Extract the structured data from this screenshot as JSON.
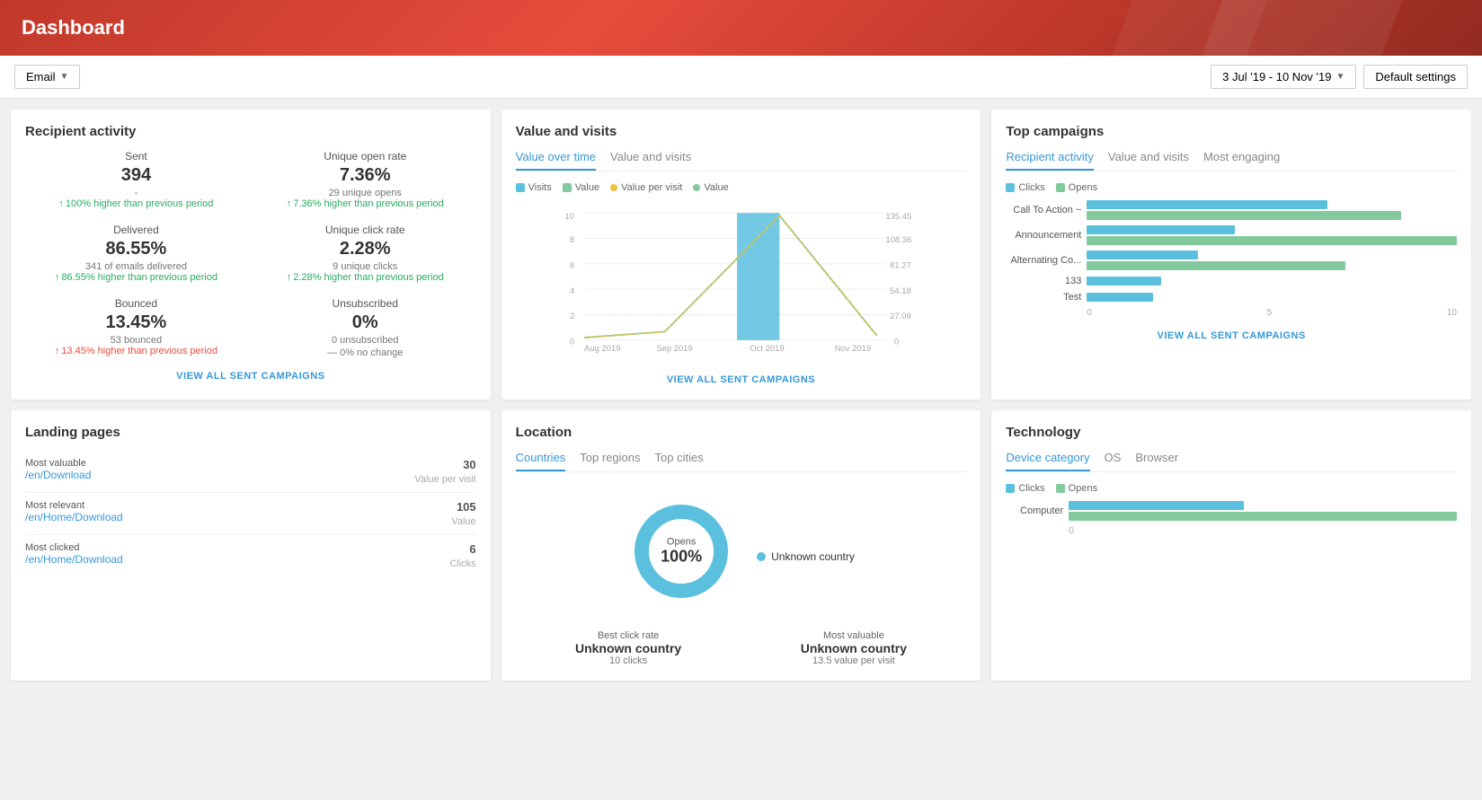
{
  "header": {
    "title": "Dashboard"
  },
  "toolbar": {
    "email_label": "Email",
    "date_range": "3 Jul '19 - 10 Nov '19",
    "settings_label": "Default settings"
  },
  "recipient_activity": {
    "title": "Recipient activity",
    "metrics": [
      {
        "label": "Sent",
        "value": "394",
        "sub": "-",
        "change": "↑ 100% higher than previous period",
        "up": true
      },
      {
        "label": "Unique open rate",
        "value": "7.36%",
        "sub": "29 unique opens",
        "change": "↑ 7.36% higher than previous period",
        "up": true
      },
      {
        "label": "Delivered",
        "value": "86.55%",
        "sub": "341 of emails delivered",
        "change": "↑ 86.55% higher than previous period",
        "up": true
      },
      {
        "label": "Unique click rate",
        "value": "2.28%",
        "sub": "9 unique clicks",
        "change": "↑ 2.28% higher than previous period",
        "up": true
      },
      {
        "label": "Bounced",
        "value": "13.45%",
        "sub": "53 bounced",
        "change": "↑ 13.45% higher than previous period",
        "up": false
      },
      {
        "label": "Unsubscribed",
        "value": "0%",
        "sub": "0 unsubscribed",
        "change": "— 0% no change",
        "neutral": true
      }
    ],
    "view_all": "VIEW ALL SENT CAMPAIGNS"
  },
  "value_visits": {
    "title": "Value and visits",
    "tabs": [
      "Value over time",
      "Value and visits"
    ],
    "active_tab": 0,
    "legend": [
      {
        "label": "Visits",
        "type": "square",
        "color": "blue"
      },
      {
        "label": "Value",
        "type": "square",
        "color": "green"
      },
      {
        "label": "Value per visit",
        "type": "circle",
        "color": "yellow"
      },
      {
        "label": "Value",
        "type": "circle",
        "color": "green2"
      }
    ],
    "x_labels": [
      "Aug 2019",
      "Sep 2019",
      "Oct 2019",
      "Nov 2019"
    ],
    "y_left": [
      "0",
      "2",
      "4",
      "6",
      "8",
      "10"
    ],
    "y_right": [
      "0",
      "27.09",
      "54.18",
      "81.27",
      "108.36",
      "135.45"
    ],
    "view_all": "VIEW ALL SENT CAMPAIGNS"
  },
  "top_campaigns": {
    "title": "Top campaigns",
    "tabs": [
      "Recipient activity",
      "Value and visits",
      "Most engaging"
    ],
    "active_tab": 0,
    "legend": [
      {
        "label": "Clicks",
        "color": "blue"
      },
      {
        "label": "Opens",
        "color": "green"
      }
    ],
    "campaigns": [
      {
        "name": "Call To Action ~",
        "clicks": 65,
        "opens": 85
      },
      {
        "name": "Announcement",
        "clicks": 40,
        "opens": 100
      },
      {
        "name": "Alternating Co...",
        "clicks": 30,
        "opens": 70
      },
      {
        "name": "133",
        "clicks": 20,
        "opens": 0
      },
      {
        "name": "Test",
        "clicks": 18,
        "opens": 0
      }
    ],
    "axis_labels": [
      "0",
      "5",
      "10"
    ],
    "view_all": "VIEW ALL SENT CAMPAIGNS"
  },
  "landing_pages": {
    "title": "Landing pages",
    "items": [
      {
        "type": "Most valuable",
        "link": "/en/Download",
        "value": "30",
        "unit": "Value per visit"
      },
      {
        "type": "Most relevant",
        "link": "/en/Home/Download",
        "value": "105",
        "unit": "Value"
      },
      {
        "type": "Most clicked",
        "link": "/en/Home/Download",
        "value": "6",
        "unit": "Clicks"
      }
    ]
  },
  "location": {
    "title": "Location",
    "tabs": [
      "Countries",
      "Top regions",
      "Top cities"
    ],
    "active_tab": 0,
    "donut": {
      "label": "Opens",
      "value": "100%",
      "legend": [
        {
          "label": "Unknown country",
          "color": "#5bc0de"
        }
      ]
    },
    "stats": [
      {
        "label": "Best click rate",
        "name": "Unknown country",
        "sub": "10 clicks"
      },
      {
        "label": "Most valuable",
        "name": "Unknown country",
        "sub": "13.5 value per visit"
      }
    ]
  },
  "technology": {
    "title": "Technology",
    "tabs": [
      "Device category",
      "OS",
      "Browser"
    ],
    "active_tab": 0,
    "legend": [
      {
        "label": "Clicks",
        "color": "blue"
      },
      {
        "label": "Opens",
        "color": "green"
      }
    ],
    "items": [
      {
        "name": "Computer",
        "clicks": 45,
        "opens": 100
      }
    ],
    "axis_label": "0"
  }
}
